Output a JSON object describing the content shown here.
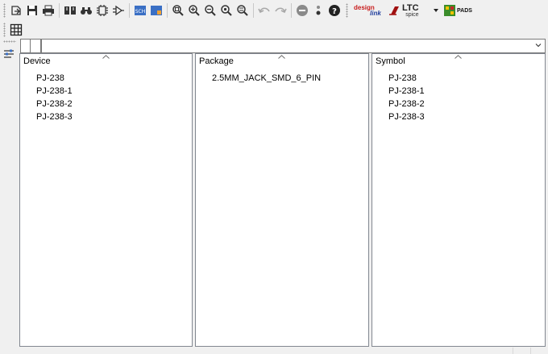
{
  "toolbar": {
    "buttons": [
      {
        "icon": "open-icon"
      },
      {
        "icon": "save-icon"
      },
      {
        "icon": "print-icon"
      },
      {
        "icon": "book-icon"
      },
      {
        "icon": "binoculars-icon"
      },
      {
        "icon": "package-icon"
      },
      {
        "icon": "symbol-icon"
      },
      {
        "icon": "schematic-icon"
      },
      {
        "icon": "board-icon"
      },
      {
        "icon": "zoom-fit-icon"
      },
      {
        "icon": "zoom-in-icon"
      },
      {
        "icon": "zoom-out-icon"
      },
      {
        "icon": "zoom-redraw-icon"
      },
      {
        "icon": "zoom-select-icon"
      },
      {
        "icon": "undo-icon"
      },
      {
        "icon": "redo-icon"
      },
      {
        "icon": "stop-icon"
      },
      {
        "icon": "more-icon"
      },
      {
        "icon": "help-icon"
      }
    ],
    "brands": {
      "design_link": {
        "word1": "design",
        "word2": "link"
      },
      "ltspice": {
        "big": "LTC",
        "small": "spice"
      },
      "pads": {
        "label": "PADS"
      }
    }
  },
  "colors": {
    "panel_border": "#828790",
    "background": "#f0f0f0",
    "accent_blue": "#1e5aa8",
    "design_red": "#c81e1e"
  },
  "panels": {
    "device": {
      "header": "Device",
      "items": [
        "PJ-238",
        "PJ-238-1",
        "PJ-238-2",
        "PJ-238-3"
      ]
    },
    "package": {
      "header": "Package",
      "items": [
        "2.5MM_JACK_SMD_6_PIN"
      ]
    },
    "symbol": {
      "header": "Symbol",
      "items": [
        "PJ-238",
        "PJ-238-1",
        "PJ-238-2",
        "PJ-238-3"
      ]
    }
  },
  "filter": {
    "value": ""
  }
}
